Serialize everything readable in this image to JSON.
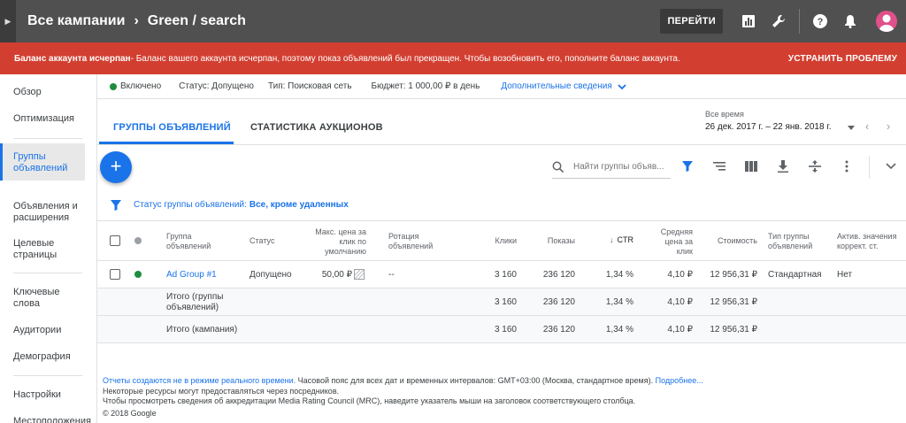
{
  "topbar": {
    "crumb_campaigns": "Все кампании",
    "crumb_sep": "›",
    "crumb_current": "Green / search",
    "go_button": "ПЕРЕЙТИ"
  },
  "alert": {
    "title": "Баланс аккаунта исчерпан",
    "message": " - Баланс вашего аккаунта исчерпан, поэтому показ объявлений был прекращен. Чтобы возобновить его, пополните баланс аккаунта.",
    "action": "УСТРАНИТЬ ПРОБЛЕМУ"
  },
  "sidebar": {
    "items": [
      {
        "label": "Обзор"
      },
      {
        "label": "Оптимизация"
      },
      {
        "label": "Группы объявлений"
      },
      {
        "label": "Объявления и расширения"
      },
      {
        "label": "Целевые страницы"
      },
      {
        "label": "Ключевые слова"
      },
      {
        "label": "Аудитории"
      },
      {
        "label": "Демография"
      },
      {
        "label": "Настройки"
      },
      {
        "label": "Местоположения"
      }
    ]
  },
  "status": {
    "enabled": "Включено",
    "status": "Статус: Допущено",
    "type": "Тип: Поисковая сеть",
    "budget": "Бюджет: 1 000,00 ₽ в день",
    "more": "Дополнительные сведения"
  },
  "tabs": {
    "ad_groups": "ГРУППЫ ОБЪЯВЛЕНИЙ",
    "auction": "СТАТИСТИКА АУКЦИОНОВ"
  },
  "date": {
    "label": "Все время",
    "range": "26 дек. 2017 г. – 22 янв. 2018 г."
  },
  "toolbar": {
    "add": "+",
    "search_placeholder": "Найти группы объяв..."
  },
  "filter": {
    "label": "Статус группы объявлений:",
    "value": "Все, кроме удаленных"
  },
  "table": {
    "headers": {
      "group": "Группа объявлений",
      "status": "Статус",
      "max_cpc": "Макс. цена за клик по умолчанию",
      "rotation": "Ротация объявлений",
      "clicks": "Клики",
      "impressions": "Показы",
      "ctr": "CTR",
      "avg_cpc": "Средняя цена за клик",
      "cost": "Стоимость",
      "group_type": "Тип группы объявлений",
      "active_bid": "Актив. значения коррект. ст."
    },
    "rows": [
      {
        "group": "Ad Group #1",
        "status": "Допущено",
        "max_cpc": "50,00 ₽",
        "rotation": "--",
        "clicks": "3 160",
        "impressions": "236 120",
        "ctr": "1,34 %",
        "avg_cpc": "4,10 ₽",
        "cost": "12 956,31 ₽",
        "group_type": "Стандартная",
        "active_bid": "Нет"
      }
    ],
    "totals": [
      {
        "label": "Итого (группы объявлений)",
        "clicks": "3 160",
        "impressions": "236 120",
        "ctr": "1,34 %",
        "avg_cpc": "4,10 ₽",
        "cost": "12 956,31 ₽"
      },
      {
        "label": "Итого (кампания)",
        "clicks": "3 160",
        "impressions": "236 120",
        "ctr": "1,34 %",
        "avg_cpc": "4,10 ₽",
        "cost": "12 956,31 ₽"
      }
    ]
  },
  "footer": {
    "line1_link": "Отчеты создаются не в режиме реального времени.",
    "line1_text": " Часовой пояс для всех дат и временных интервалов: GMT+03:00 (Москва, стандартное время).",
    "line1_more": " Подробнее...",
    "line2": "Некоторые ресурсы могут предоставляться через посредников.",
    "line3": "Чтобы просмотреть сведения об аккредитации Media Rating Council (MRC), наведите указатель мыши на заголовок соответствующего столбца.",
    "copyright": "© 2018 Google"
  },
  "colors": {
    "topbar": "#505050",
    "alert": "#d23f31",
    "accent": "#1a73e8",
    "enabled": "#1e8e3e"
  }
}
